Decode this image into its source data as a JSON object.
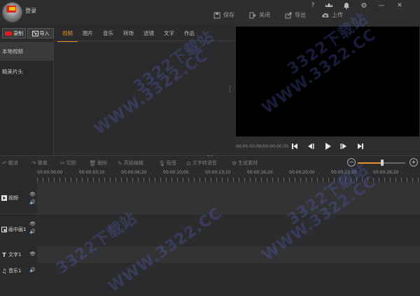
{
  "header": {
    "login": "登录",
    "buttons": [
      {
        "label": "保存",
        "icon": "save-icon"
      },
      {
        "label": "关闭",
        "icon": "close-project-icon"
      },
      {
        "label": "导出",
        "icon": "export-icon"
      },
      {
        "label": "上传",
        "icon": "upload-icon"
      }
    ],
    "window_icons": [
      {
        "symbol": "?",
        "name": "help-icon"
      },
      {
        "symbol": "VIP",
        "name": "vip-crown-icon"
      },
      {
        "symbol": "🔔",
        "name": "bell-icon"
      },
      {
        "symbol": "⚙",
        "name": "gear-icon"
      },
      {
        "symbol": "—",
        "name": "minimize-icon"
      },
      {
        "symbol": "✕",
        "name": "window-close-icon"
      }
    ]
  },
  "left": {
    "record_label": "录制",
    "import_label": "导入",
    "tabs": [
      "视频",
      "图片",
      "音乐",
      "转场",
      "滤镜",
      "文字",
      "作品"
    ],
    "active_tab": 0,
    "sidebar": [
      "本地视频",
      "精美片头"
    ],
    "active_sidebar": 0
  },
  "preview": {
    "timecode": "00:00:00:00/00:00:00:00"
  },
  "toolbar": {
    "tools": [
      {
        "label": "撤消",
        "icon": "undo-icon"
      },
      {
        "label": "重做",
        "icon": "redo-icon"
      },
      {
        "label": "切割",
        "icon": "scissors-icon"
      },
      {
        "label": "删除",
        "icon": "trash-icon"
      },
      {
        "label": "高级编辑",
        "icon": "pencil-icon"
      },
      {
        "label": "配音",
        "icon": "microphone-icon"
      },
      {
        "label": "文字转语音",
        "icon": "text-to-speech-icon"
      },
      {
        "label": "生成素材",
        "icon": "generate-material-icon"
      }
    ],
    "zoom_level": 0.52
  },
  "timeline": {
    "ticks": [
      "00:00:00:00",
      "00:00:03;10",
      "00:00:06;20",
      "00:00:10;00",
      "00:00:13;10",
      "00:00:16;20",
      "00:00:20;00",
      "00:00:23;10",
      "00:00:26;20"
    ],
    "tracks": [
      {
        "label": "视频",
        "icon": "play-box-icon"
      },
      {
        "label": "画中画1",
        "icon": "pip-icon"
      },
      {
        "label": "文字1",
        "icon": "text-t-icon"
      },
      {
        "label": "音乐1",
        "icon": "music-note-icon"
      }
    ]
  },
  "watermark": "3322下载站",
  "watermark_url": "WWW.3322.CC",
  "colors": {
    "accent": "#e8902c",
    "record_red": "#e01e1e",
    "preview_bg": "#000000"
  }
}
